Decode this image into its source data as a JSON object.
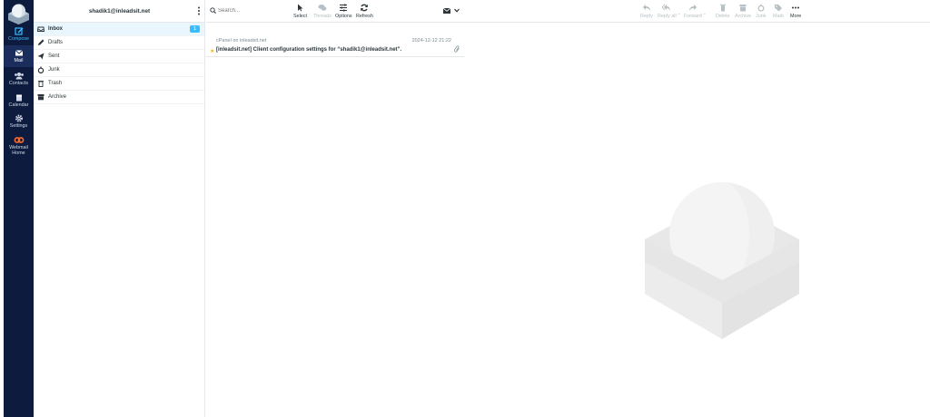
{
  "account": "shadik1@inleadsit.net",
  "nav": {
    "compose": "Compose",
    "mail": "Mail",
    "contacts": "Contacts",
    "calendar": "Calendar",
    "settings": "Settings",
    "webmail_home_1": "Webmail",
    "webmail_home_2": "Home"
  },
  "folders": [
    {
      "label": "Inbox",
      "icon": "inbox-icon",
      "unread": "1",
      "active": true
    },
    {
      "label": "Drafts",
      "icon": "pencil-icon"
    },
    {
      "label": "Sent",
      "icon": "paper-plane-icon"
    },
    {
      "label": "Junk",
      "icon": "fire-icon"
    },
    {
      "label": "Trash",
      "icon": "trash-icon"
    },
    {
      "label": "Archive",
      "icon": "archive-icon"
    }
  ],
  "search": {
    "placeholder": "Search..."
  },
  "toolbar": {
    "select": "Select",
    "threads": "Threads",
    "options": "Options",
    "refresh": "Refresh",
    "reply": "Reply",
    "reply_all": "Reply all",
    "forward": "Forward",
    "delete": "Delete",
    "archive": "Archive",
    "junk": "Junk",
    "mark": "Mark",
    "more": "More"
  },
  "messages": [
    {
      "from": "cPanel on inleadsit.net",
      "date": "2024-12-12 21:22",
      "subject": "[inleadsit.net] Client configuration settings for “shadik1@inleadsit.net”.",
      "has_attachment": true,
      "flag_color": "#ffb70b"
    }
  ],
  "colors": {
    "nav_bg": "#0d1b3e",
    "accent": "#37beff",
    "active_folder_bg": "#e9f6fd"
  }
}
